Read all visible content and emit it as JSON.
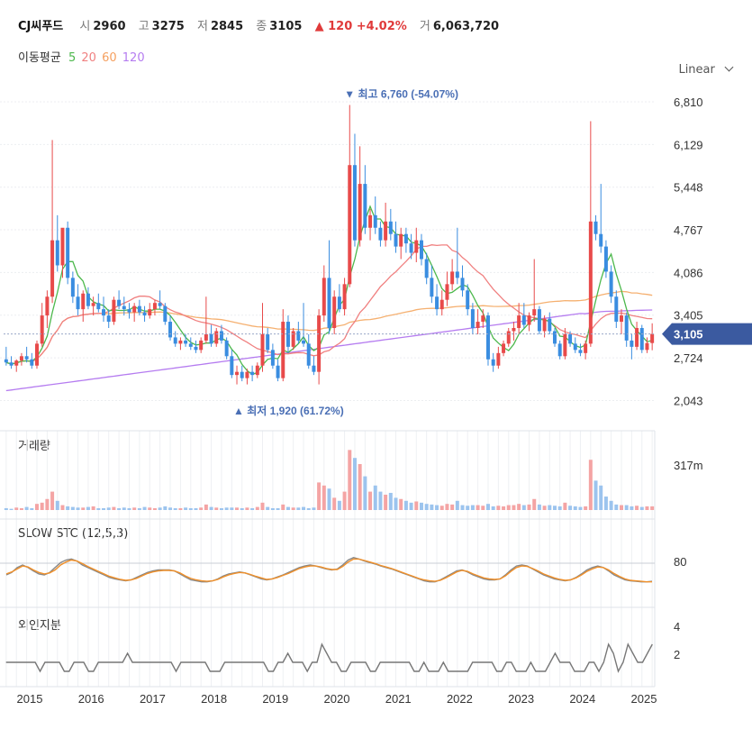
{
  "header": {
    "name": "CJ씨푸드",
    "open_label": "시",
    "open": "2960",
    "high_label": "고",
    "high": "3275",
    "low_label": "저",
    "low": "2845",
    "close_label": "종",
    "close": "3105",
    "change": "▲ 120 +4.02%",
    "volume_label": "거",
    "volume": "6,063,720"
  },
  "ma_legend": {
    "label": "이동평균",
    "p5": "5",
    "p20": "20",
    "p60": "60",
    "p120": "120"
  },
  "scale_label": "Linear",
  "colors": {
    "up": "#e84a4a",
    "down": "#3a8de0",
    "ma5": "#4cb84c",
    "ma20": "#f08080",
    "ma60": "#f5b070",
    "ma120": "#b57cf0",
    "stc_k": "#888888",
    "stc_d": "#f0902a",
    "badge": "#3b5aa0"
  },
  "chart_data": [
    {
      "type": "candlestick",
      "ylim": [
        1920,
        6810
      ],
      "y_ticks": [
        "6,810",
        "6,129",
        "5,448",
        "4,767",
        "4,086",
        "3,405",
        "2,724",
        "2,043"
      ],
      "x_ticks": [
        "2015",
        "2016",
        "2017",
        "2018",
        "2019",
        "2020",
        "2021",
        "2022",
        "2023",
        "2024",
        "2025"
      ],
      "annotations": {
        "high": "▼ 최고 6,760 (-54.07%)",
        "low": "▲ 최저 1,920 (61.72%)"
      },
      "current_price": "3,105",
      "ohlc": [
        [
          2700,
          2900,
          2600,
          2650
        ],
        [
          2650,
          2750,
          2550,
          2600
        ],
        [
          2600,
          2700,
          2500,
          2680
        ],
        [
          2680,
          2800,
          2600,
          2750
        ],
        [
          2750,
          2900,
          2650,
          2700
        ],
        [
          2700,
          2800,
          2550,
          2600
        ],
        [
          2600,
          3000,
          2550,
          2950
        ],
        [
          2950,
          3600,
          2900,
          3400
        ],
        [
          3400,
          3800,
          3200,
          3700
        ],
        [
          3700,
          6200,
          3600,
          4600
        ],
        [
          4600,
          5000,
          4100,
          4200
        ],
        [
          4200,
          4700,
          4000,
          4800
        ],
        [
          4800,
          4900,
          3900,
          4000
        ],
        [
          4000,
          4100,
          3600,
          3700
        ],
        [
          3700,
          3900,
          3400,
          3500
        ],
        [
          3500,
          3800,
          3300,
          3750
        ],
        [
          3750,
          3850,
          3500,
          3550
        ],
        [
          3550,
          3700,
          3400,
          3600
        ],
        [
          3600,
          3750,
          3450,
          3500
        ],
        [
          3500,
          3700,
          3300,
          3400
        ],
        [
          3400,
          3500,
          3200,
          3300
        ],
        [
          3300,
          3700,
          3250,
          3650
        ],
        [
          3650,
          3800,
          3500,
          3550
        ],
        [
          3550,
          3700,
          3400,
          3500
        ],
        [
          3500,
          3600,
          3350,
          3450
        ],
        [
          3450,
          3600,
          3300,
          3550
        ],
        [
          3550,
          3650,
          3400,
          3450
        ],
        [
          3450,
          3550,
          3300,
          3400
        ],
        [
          3400,
          3600,
          3350,
          3500
        ],
        [
          3500,
          3650,
          3400,
          3600
        ],
        [
          3600,
          3800,
          3500,
          3550
        ],
        [
          3550,
          3600,
          3250,
          3300
        ],
        [
          3300,
          3400,
          3000,
          3050
        ],
        [
          3050,
          3150,
          2900,
          2950
        ],
        [
          2950,
          3050,
          2850,
          3000
        ],
        [
          3000,
          3100,
          2900,
          2950
        ],
        [
          2950,
          3050,
          2850,
          2900
        ],
        [
          2900,
          3000,
          2800,
          2850
        ],
        [
          2850,
          3050,
          2800,
          3000
        ],
        [
          3000,
          3700,
          2950,
          3100
        ],
        [
          3100,
          3250,
          2900,
          2950
        ],
        [
          2950,
          3200,
          2900,
          3150
        ],
        [
          3150,
          3250,
          2950,
          3000
        ],
        [
          3000,
          3050,
          2700,
          2750
        ],
        [
          2750,
          2850,
          2400,
          2450
        ],
        [
          2450,
          2600,
          2300,
          2500
        ],
        [
          2500,
          2600,
          2350,
          2400
        ],
        [
          2400,
          2550,
          2300,
          2500
        ],
        [
          2500,
          2600,
          2350,
          2450
        ],
        [
          2450,
          2650,
          2400,
          2600
        ],
        [
          2600,
          3600,
          2500,
          3100
        ],
        [
          3100,
          3200,
          2800,
          2850
        ],
        [
          2850,
          2950,
          2550,
          2600
        ],
        [
          2600,
          2700,
          2350,
          2400
        ],
        [
          2400,
          3500,
          2350,
          3300
        ],
        [
          3300,
          3400,
          2800,
          2900
        ],
        [
          2900,
          3200,
          2850,
          3150
        ],
        [
          3150,
          3300,
          2950,
          3000
        ],
        [
          3000,
          3600,
          2900,
          2950
        ],
        [
          2950,
          3100,
          2550,
          2600
        ],
        [
          2600,
          2750,
          2450,
          2500
        ],
        [
          2500,
          3500,
          2300,
          3400
        ],
        [
          3400,
          4200,
          3300,
          4000
        ],
        [
          4000,
          4600,
          3100,
          3200
        ],
        [
          3200,
          3800,
          3100,
          3700
        ],
        [
          3700,
          3900,
          3450,
          3500
        ],
        [
          3500,
          4000,
          3400,
          3900
        ],
        [
          3900,
          6760,
          3850,
          5800
        ],
        [
          5800,
          6300,
          4500,
          4600
        ],
        [
          4600,
          6100,
          4500,
          5500
        ],
        [
          5500,
          5800,
          4700,
          4800
        ],
        [
          4800,
          5100,
          4600,
          5000
        ],
        [
          5000,
          5300,
          4700,
          4800
        ],
        [
          4800,
          4900,
          4500,
          4600
        ],
        [
          4600,
          5200,
          4500,
          4900
        ],
        [
          4900,
          5100,
          4600,
          4700
        ],
        [
          4700,
          4900,
          4400,
          4500
        ],
        [
          4500,
          4800,
          4300,
          4700
        ],
        [
          4700,
          4800,
          4400,
          4550
        ],
        [
          4550,
          4700,
          4300,
          4400
        ],
        [
          4400,
          4800,
          4250,
          4600
        ],
        [
          4600,
          4700,
          4200,
          4300
        ],
        [
          4300,
          4400,
          3900,
          4000
        ],
        [
          4000,
          4200,
          3600,
          3700
        ],
        [
          3700,
          3900,
          3400,
          3500
        ],
        [
          3500,
          3800,
          3400,
          3650
        ],
        [
          3650,
          4100,
          3550,
          3900
        ],
        [
          3900,
          4300,
          3800,
          4100
        ],
        [
          4100,
          4800,
          3900,
          4000
        ],
        [
          4000,
          4200,
          3700,
          3800
        ],
        [
          3800,
          3900,
          3400,
          3500
        ],
        [
          3500,
          3600,
          3100,
          3200
        ],
        [
          3200,
          3500,
          3100,
          3300
        ],
        [
          3300,
          3500,
          3200,
          3400
        ],
        [
          3400,
          3450,
          2600,
          2700
        ],
        [
          2700,
          2800,
          2500,
          2600
        ],
        [
          2600,
          2900,
          2550,
          2800
        ],
        [
          2800,
          3000,
          2750,
          2950
        ],
        [
          2950,
          3200,
          2900,
          3150
        ],
        [
          3150,
          3300,
          3000,
          3200
        ],
        [
          3200,
          3600,
          3100,
          3400
        ],
        [
          3400,
          3600,
          3200,
          3250
        ],
        [
          3250,
          3450,
          3150,
          3400
        ],
        [
          3400,
          4300,
          3300,
          3500
        ],
        [
          3500,
          3550,
          3100,
          3150
        ],
        [
          3150,
          3400,
          3050,
          3350
        ],
        [
          3350,
          3450,
          3100,
          3150
        ],
        [
          3150,
          3200,
          2900,
          2950
        ],
        [
          2950,
          3000,
          2700,
          2750
        ],
        [
          2750,
          3200,
          2700,
          3100
        ],
        [
          3100,
          3150,
          2900,
          2950
        ],
        [
          2950,
          3050,
          2800,
          2850
        ],
        [
          2850,
          2950,
          2750,
          2800
        ],
        [
          2800,
          3000,
          2700,
          2950
        ],
        [
          2950,
          6500,
          2900,
          4900
        ],
        [
          4900,
          5000,
          4600,
          4700
        ],
        [
          4700,
          5500,
          4400,
          4500
        ],
        [
          4500,
          4600,
          4000,
          4100
        ],
        [
          4100,
          4200,
          3600,
          3700
        ],
        [
          3700,
          3800,
          3200,
          3300
        ],
        [
          3300,
          3500,
          3100,
          3400
        ],
        [
          3400,
          3450,
          2900,
          3000
        ],
        [
          3000,
          3100,
          2700,
          2900
        ],
        [
          2900,
          3300,
          2850,
          3200
        ],
        [
          3200,
          3250,
          2800,
          2850
        ],
        [
          2850,
          3050,
          2800,
          2960
        ],
        [
          2960,
          3275,
          2845,
          3105
        ]
      ]
    },
    {
      "type": "bar",
      "title": "거래량",
      "y_ticks": [
        "317m"
      ],
      "values": [
        3,
        2,
        4,
        3,
        5,
        3,
        10,
        12,
        18,
        30,
        15,
        8,
        6,
        5,
        4,
        4,
        5,
        6,
        3,
        3,
        4,
        5,
        3,
        4,
        3,
        4,
        3,
        5,
        4,
        3,
        4,
        6,
        4,
        3,
        3,
        4,
        3,
        3,
        4,
        9,
        5,
        4,
        3,
        4,
        4,
        4,
        3,
        4,
        3,
        5,
        12,
        5,
        3,
        3,
        9,
        5,
        4,
        4,
        5,
        3,
        4,
        45,
        40,
        35,
        20,
        15,
        30,
        98,
        85,
        75,
        55,
        30,
        40,
        30,
        25,
        28,
        20,
        18,
        15,
        12,
        14,
        12,
        10,
        9,
        8,
        7,
        10,
        9,
        15,
        8,
        7,
        8,
        8,
        7,
        10,
        6,
        7,
        6,
        8,
        8,
        10,
        8,
        9,
        18,
        9,
        7,
        8,
        7,
        6,
        12,
        7,
        6,
        5,
        6,
        82,
        48,
        40,
        22,
        15,
        9,
        8,
        8,
        6,
        7,
        5,
        6,
        6
      ]
    },
    {
      "type": "line",
      "title": "SLOW STC (12,5,3)",
      "y_ticks": [
        "80"
      ],
      "series": [
        {
          "values": [
            40,
            45,
            55,
            60,
            55,
            48,
            42,
            40,
            45,
            55,
            65,
            70,
            72,
            68,
            60,
            55,
            50,
            45,
            40,
            35,
            32,
            30,
            28,
            30,
            35,
            40,
            45,
            48,
            50,
            50,
            50,
            48,
            42,
            36,
            30,
            28,
            26,
            26,
            28,
            32,
            38,
            42,
            44,
            46,
            44,
            40,
            36,
            32,
            30,
            32,
            36,
            40,
            45,
            50,
            55,
            58,
            60,
            58,
            55,
            52,
            50,
            52,
            60,
            70,
            75,
            72,
            68,
            65,
            62,
            58,
            55,
            52,
            48,
            44,
            40,
            36,
            32,
            28,
            26,
            26,
            30,
            36,
            42,
            48,
            50,
            46,
            40,
            36,
            32,
            30,
            30,
            32,
            40,
            50,
            58,
            60,
            58,
            52,
            46,
            40,
            36,
            32,
            30,
            28,
            30,
            35,
            42,
            50,
            55,
            58,
            55,
            48,
            40,
            35,
            30,
            28,
            27,
            26,
            26,
            27
          ]
        },
        {
          "values": [
            42,
            46,
            52,
            58,
            56,
            50,
            45,
            42,
            44,
            50,
            60,
            66,
            70,
            68,
            63,
            57,
            52,
            47,
            42,
            37,
            34,
            31,
            29,
            30,
            33,
            38,
            43,
            46,
            48,
            49,
            49,
            48,
            44,
            38,
            33,
            30,
            28,
            27,
            28,
            31,
            36,
            40,
            43,
            45,
            44,
            41,
            37,
            34,
            31,
            32,
            35,
            39,
            43,
            48,
            53,
            56,
            58,
            58,
            56,
            53,
            51,
            51,
            57,
            66,
            72,
            72,
            69,
            66,
            63,
            59,
            56,
            53,
            49,
            45,
            41,
            37,
            33,
            30,
            28,
            27,
            29,
            34,
            40,
            46,
            49,
            47,
            42,
            38,
            34,
            32,
            31,
            32,
            38,
            47,
            55,
            58,
            57,
            53,
            48,
            42,
            38,
            34,
            31,
            29,
            30,
            34,
            40,
            47,
            52,
            56,
            55,
            50,
            43,
            37,
            32,
            29,
            28,
            27,
            26,
            26
          ]
        }
      ]
    },
    {
      "type": "line",
      "title": "외인지분",
      "y_ticks": [
        "4",
        "2"
      ],
      "series": [
        {
          "values": [
            1,
            1,
            1,
            1,
            1,
            1,
            1,
            0,
            1,
            1,
            1,
            1,
            0,
            0,
            1,
            1,
            1,
            0,
            0,
            1,
            1,
            1,
            1,
            1,
            1,
            2,
            1,
            1,
            1,
            1,
            1,
            1,
            1,
            1,
            1,
            0,
            1,
            1,
            1,
            1,
            1,
            1,
            0,
            0,
            0,
            1,
            1,
            1,
            1,
            1,
            1,
            1,
            1,
            1,
            0,
            0,
            1,
            1,
            2,
            1,
            1,
            1,
            0,
            1,
            1,
            3,
            2,
            1,
            1,
            0,
            0,
            1,
            1,
            1,
            1,
            0,
            0,
            1,
            1,
            1,
            1,
            1,
            1,
            1,
            0,
            0,
            1,
            0,
            0,
            0,
            1,
            0,
            0,
            0,
            0,
            0,
            1,
            1,
            1,
            1,
            1,
            0,
            0,
            1,
            1,
            0,
            0,
            0,
            1,
            0,
            0,
            0,
            1,
            2,
            1,
            1,
            1,
            0,
            0,
            0,
            1,
            1,
            0,
            1,
            3,
            2,
            0,
            1,
            3,
            2,
            1,
            1,
            2,
            3
          ]
        }
      ]
    }
  ]
}
